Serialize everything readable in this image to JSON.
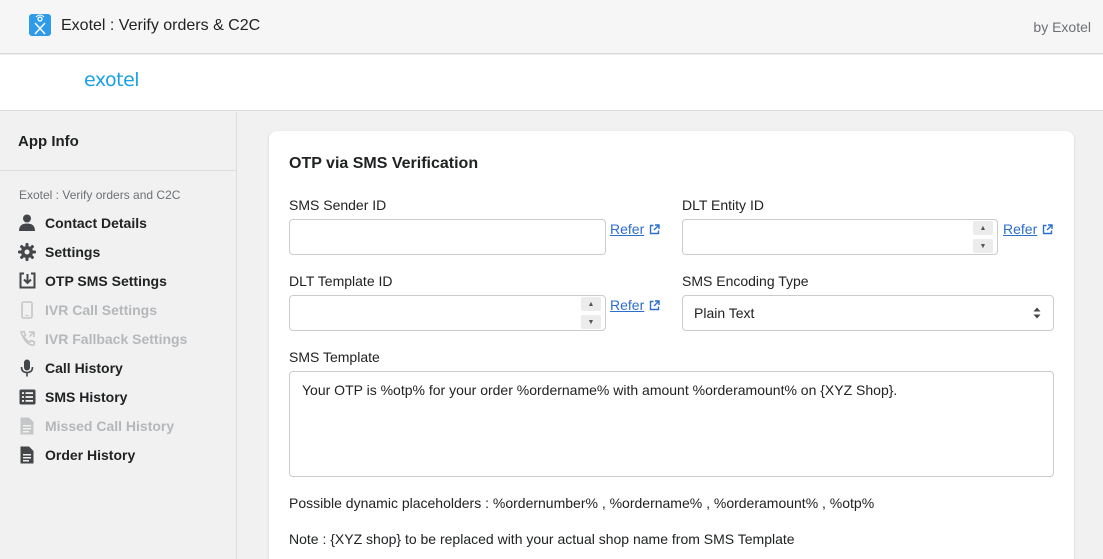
{
  "header": {
    "app_title": "Exotel : Verify orders & C2C",
    "by_vendor": "by Exotel",
    "app_icon": "exotel-app-icon"
  },
  "brand": {
    "logo_text": "exotel",
    "logo_color": "#1aa0e6"
  },
  "sidebar": {
    "app_info": "App Info",
    "section_label": "Exotel : Verify orders and C2C",
    "items": [
      {
        "label": "Contact Details",
        "icon": "person-icon",
        "enabled": true
      },
      {
        "label": "Settings",
        "icon": "gear-icon",
        "enabled": true
      },
      {
        "label": "OTP SMS Settings",
        "icon": "download-box-icon",
        "enabled": true
      },
      {
        "label": "IVR Call Settings",
        "icon": "mobile-icon",
        "enabled": false
      },
      {
        "label": "IVR Fallback Settings",
        "icon": "phone-forward-icon",
        "enabled": false
      },
      {
        "label": "Call History",
        "icon": "microphone-icon",
        "enabled": true
      },
      {
        "label": "SMS History",
        "icon": "list-icon",
        "enabled": true
      },
      {
        "label": "Missed Call History",
        "icon": "document-icon",
        "enabled": false
      },
      {
        "label": "Order History",
        "icon": "document-icon",
        "enabled": true
      }
    ]
  },
  "form": {
    "title": "OTP via SMS Verification",
    "sms_sender_id": {
      "label": "SMS Sender ID",
      "value": "",
      "refer": "Refer"
    },
    "dlt_entity_id": {
      "label": "DLT Entity ID",
      "value": "",
      "refer": "Refer"
    },
    "dlt_template_id": {
      "label": "DLT Template ID",
      "value": "",
      "refer": "Refer"
    },
    "sms_encoding_type": {
      "label": "SMS Encoding Type",
      "value": "Plain Text"
    },
    "sms_template": {
      "label": "SMS Template",
      "value": "Your OTP is %otp% for your order %ordername% with amount %orderamount% on {XYZ Shop}."
    },
    "placeholders_note": "Possible dynamic placeholders : %ordernumber% , %ordername% , %orderamount% , %otp%",
    "shop_note": "Note : {XYZ shop} to be replaced with your actual shop name from SMS Template"
  },
  "colors": {
    "accent": "#2f9be8",
    "link": "#2c6ecb",
    "disabled_text": "#b5b8bb"
  }
}
